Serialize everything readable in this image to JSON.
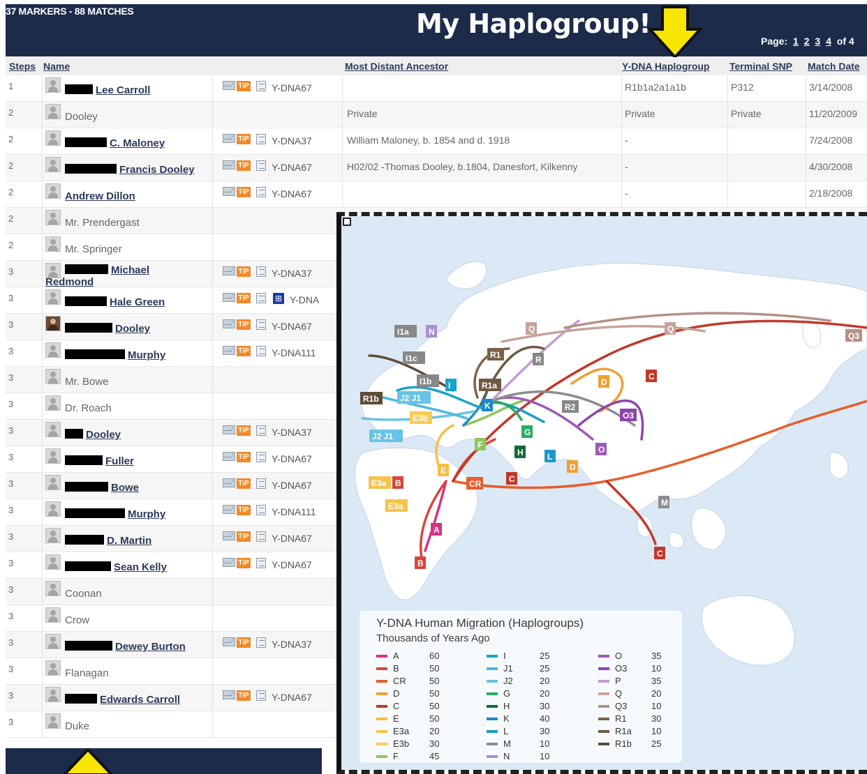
{
  "header": {
    "summary": "37 MARKERS - 88 MATCHES",
    "callout": "My Haplogroup!",
    "pager": {
      "label": "Page:",
      "pages": [
        "1",
        "2",
        "3",
        "4"
      ],
      "current": "4",
      "total_text": "of 4"
    },
    "arrow_color": "#f7e600"
  },
  "columns": {
    "steps": "Steps",
    "name": "Name",
    "ancestor": "Most Distant Ancestor",
    "haplogroup": "Y-DNA Haplogroup",
    "snp": "Terminal SNP",
    "date": "Match Date"
  },
  "matches": [
    {
      "steps": "1",
      "name": "Lee Carroll",
      "redact_w": 40,
      "link": true,
      "test": "Y-DNA67",
      "tip": true,
      "ancestor": "",
      "haplogroup": "R1b1a2a1a1b",
      "snp": "P312",
      "date": "3/14/2008"
    },
    {
      "steps": "2",
      "name": "Dooley",
      "redact_w": 0,
      "link": false,
      "test": "",
      "tip": false,
      "ancestor": "Private",
      "haplogroup": "Private",
      "snp": "Private",
      "date": "11/20/2009"
    },
    {
      "steps": "2",
      "name": "C. Maloney",
      "redact_w": 60,
      "link": true,
      "test": "Y-DNA37",
      "tip": true,
      "ancestor": "William Maloney, b. 1854 and d. 1918",
      "haplogroup": "-",
      "snp": "",
      "date": "7/24/2008"
    },
    {
      "steps": "2",
      "name": "Francis Dooley",
      "redact_w": 74,
      "link": true,
      "test": "Y-DNA67",
      "tip": true,
      "ancestor": "H02/02 -Thomas Dooley, b.1804, Danesfort, Kilkenny",
      "haplogroup": "-",
      "snp": "",
      "date": "4/30/2008"
    },
    {
      "steps": "2",
      "name": "Andrew Dillon",
      "redact_w": 0,
      "link": true,
      "test": "Y-DNA67",
      "tip": true,
      "ancestor": "",
      "haplogroup": "-",
      "snp": "",
      "date": "2/18/2008"
    },
    {
      "steps": "2",
      "name": "Mr. Prendergast",
      "redact_w": 0,
      "link": false,
      "test": "",
      "tip": false
    },
    {
      "steps": "2",
      "name": "Mr. Springer",
      "redact_w": 0,
      "link": false,
      "test": "",
      "tip": false
    },
    {
      "steps": "3",
      "name": "Michael",
      "name2": "Redmond",
      "redact_w": 62,
      "link": true,
      "test": "Y-DNA37",
      "tip": true
    },
    {
      "steps": "3",
      "name": "Hale Green",
      "redact_w": 60,
      "link": true,
      "test": "Y-DNA",
      "tip": true,
      "tree": true
    },
    {
      "steps": "3",
      "name": "Dooley",
      "redact_w": 68,
      "link": true,
      "test": "Y-DNA67",
      "tip": true,
      "photo": true
    },
    {
      "steps": "3",
      "name": "Murphy",
      "redact_w": 86,
      "link": true,
      "test": "Y-DNA111",
      "tip": true
    },
    {
      "steps": "3",
      "name": "Mr. Bowe",
      "redact_w": 0,
      "link": false,
      "test": "",
      "tip": false
    },
    {
      "steps": "3",
      "name": "Dr. Roach",
      "redact_w": 0,
      "link": false,
      "test": "",
      "tip": false
    },
    {
      "steps": "3",
      "name": "Dooley",
      "redact_w": 26,
      "link": true,
      "test": "Y-DNA37",
      "tip": true
    },
    {
      "steps": "3",
      "name": "Fuller",
      "redact_w": 54,
      "link": true,
      "test": "Y-DNA67",
      "tip": true
    },
    {
      "steps": "3",
      "name": "Bowe",
      "redact_w": 62,
      "link": true,
      "test": "Y-DNA67",
      "tip": true
    },
    {
      "steps": "3",
      "name": "Murphy",
      "redact_w": 86,
      "link": true,
      "test": "Y-DNA111",
      "tip": true
    },
    {
      "steps": "3",
      "name": "D. Martin",
      "redact_w": 56,
      "link": true,
      "test": "Y-DNA67",
      "tip": true
    },
    {
      "steps": "3",
      "name": "Sean Kelly",
      "redact_w": 66,
      "link": true,
      "test": "Y-DNA67",
      "tip": true
    },
    {
      "steps": "3",
      "name": "Coonan",
      "redact_w": 0,
      "link": false,
      "test": "",
      "tip": false
    },
    {
      "steps": "3",
      "name": "Crow",
      "redact_w": 0,
      "link": false,
      "test": "",
      "tip": false
    },
    {
      "steps": "3",
      "name": "Dewey Burton",
      "redact_w": 68,
      "link": true,
      "test": "Y-DNA37",
      "tip": true
    },
    {
      "steps": "3",
      "name": "Flanagan",
      "redact_w": 0,
      "link": false,
      "test": "",
      "tip": false
    },
    {
      "steps": "3",
      "name": "Edwards Carroll",
      "redact_w": 46,
      "link": true,
      "test": "Y-DNA67",
      "tip": true
    },
    {
      "steps": "3",
      "name": "Duke",
      "redact_w": 0,
      "link": false,
      "test": "",
      "tip": false
    }
  ],
  "tool_icons": {
    "mail": "mail-icon",
    "tip": "TiP",
    "note": "note-icon",
    "tree": "tree-icon"
  },
  "map": {
    "title": "Y-DNA Human Migration (Haplogroups)",
    "subtitle": "Thousands of Years Ago",
    "ocean_color": "#dbe9f6",
    "land_color": "#ffffff",
    "legend": [
      {
        "name": "A",
        "value": "60",
        "color": "#d63384"
      },
      {
        "name": "B",
        "value": "50",
        "color": "#d9453b"
      },
      {
        "name": "CR",
        "value": "50",
        "color": "#e85d2a"
      },
      {
        "name": "D",
        "value": "50",
        "color": "#f0a030"
      },
      {
        "name": "C",
        "value": "50",
        "color": "#c0392b"
      },
      {
        "name": "E",
        "value": "50",
        "color": "#f5c040"
      },
      {
        "name": "E3a",
        "value": "20",
        "color": "#f7c34a"
      },
      {
        "name": "E3b",
        "value": "30",
        "color": "#f7cd55"
      },
      {
        "name": "F",
        "value": "45",
        "color": "#8dc65a"
      },
      {
        "name": "I",
        "value": "25",
        "color": "#1aa3c8"
      },
      {
        "name": "J1",
        "value": "25",
        "color": "#4fb8e0"
      },
      {
        "name": "J2",
        "value": "20",
        "color": "#68c3e6"
      },
      {
        "name": "G",
        "value": "20",
        "color": "#27ae60"
      },
      {
        "name": "H",
        "value": "30",
        "color": "#0e6b3a"
      },
      {
        "name": "K",
        "value": "40",
        "color": "#1e88c8"
      },
      {
        "name": "L",
        "value": "30",
        "color": "#1b9ac9"
      },
      {
        "name": "M",
        "value": "10",
        "color": "#8c8c8c"
      },
      {
        "name": "N",
        "value": "10",
        "color": "#a890d0"
      },
      {
        "name": "O",
        "value": "35",
        "color": "#9b59b6"
      },
      {
        "name": "O3",
        "value": "10",
        "color": "#8e44ad"
      },
      {
        "name": "P",
        "value": "35",
        "color": "#c39bd3"
      },
      {
        "name": "Q",
        "value": "20",
        "color": "#c4a49a"
      },
      {
        "name": "Q3",
        "value": "10",
        "color": "#b39286"
      },
      {
        "name": "R1",
        "value": "30",
        "color": "#7a6248"
      },
      {
        "name": "R1a",
        "value": "10",
        "color": "#6e5a44"
      },
      {
        "name": "R1b",
        "value": "25",
        "color": "#5e4c38"
      }
    ],
    "labels": [
      "I1a",
      "N",
      "Q",
      "Q",
      "Q3",
      "I1c",
      "R1",
      "R",
      "I1b",
      "I",
      "R1a",
      "C",
      "D",
      "J2 J1",
      "K",
      "R2",
      "R1b",
      "E3b",
      "G",
      "O3",
      "J2 J1",
      "F",
      "H",
      "L",
      "O",
      "E",
      "D",
      "E3a",
      "B",
      "CR",
      "C",
      "M",
      "E3a",
      "A",
      "C",
      "B"
    ]
  }
}
